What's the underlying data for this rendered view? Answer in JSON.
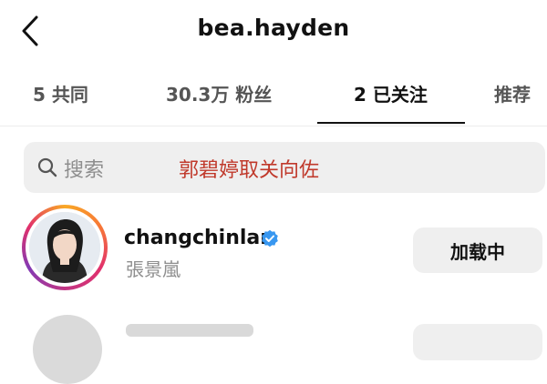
{
  "header": {
    "title": "bea.hayden",
    "back_icon": "chevron-left-icon"
  },
  "tabs": [
    {
      "label": "5 共同",
      "active": false
    },
    {
      "label": "30.3万 粉丝",
      "active": false
    },
    {
      "label": "2 已关注",
      "active": true
    },
    {
      "label": "推荐",
      "active": false
    }
  ],
  "search": {
    "placeholder": "搜索",
    "icon": "search-icon",
    "annotation": "郭碧婷取关向佐",
    "annotation_color": "#c0392b"
  },
  "list": [
    {
      "username": "changchinlan",
      "verified": true,
      "full_name": "張景嵐",
      "button_label": "加载中"
    }
  ],
  "colors": {
    "verified_blue": "#3897f0",
    "button_bg": "#efefef",
    "search_bg": "#efefef"
  }
}
